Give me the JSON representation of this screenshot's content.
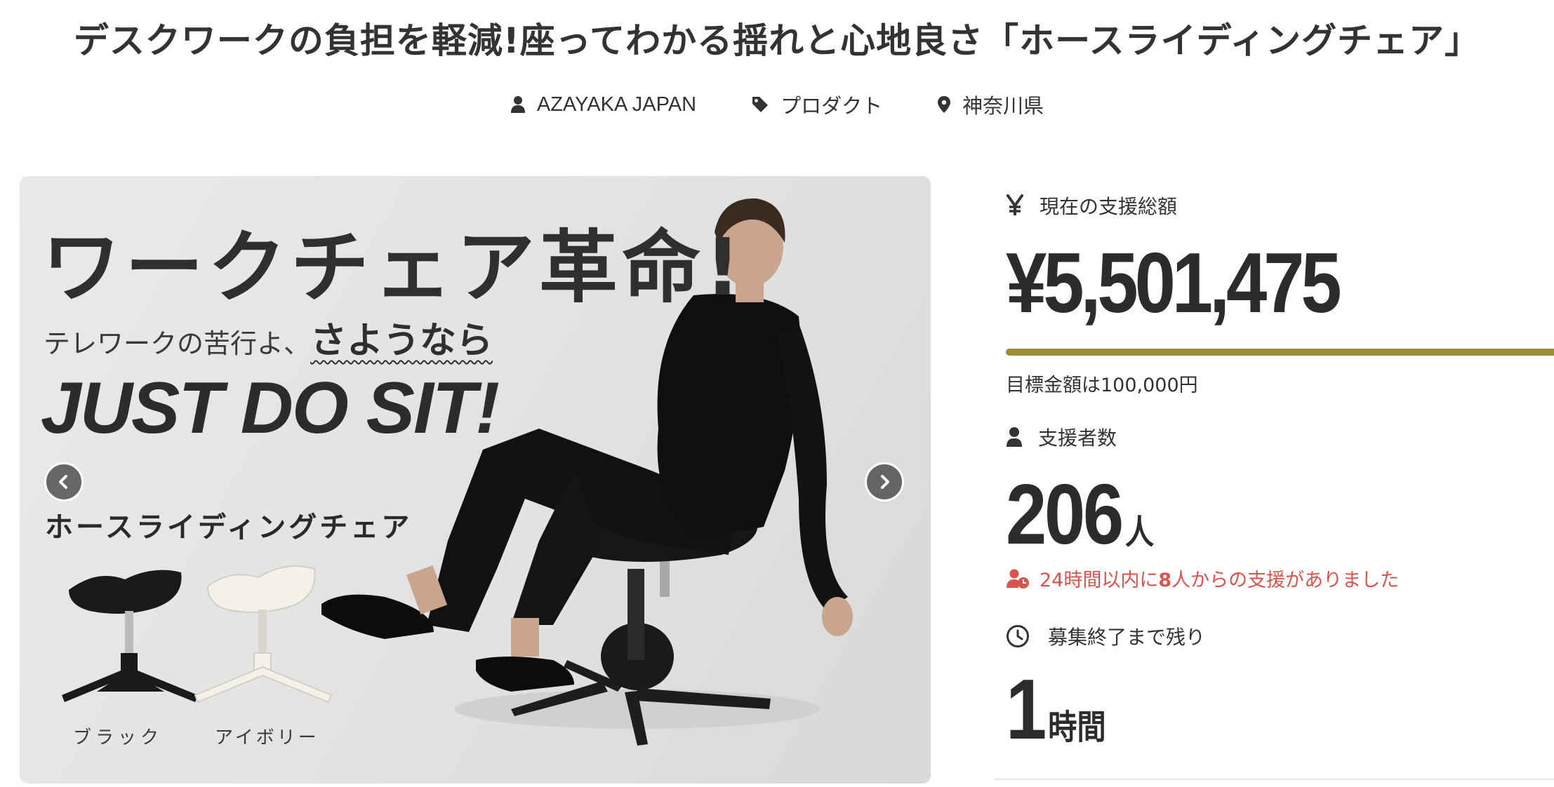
{
  "header": {
    "title": "デスクワークの負担を軽減!座ってわかる揺れと心地良さ「ホースライディングチェア」",
    "meta": {
      "owner": "AZAYAKA JAPAN",
      "category": "プロダクト",
      "location": "神奈川県"
    }
  },
  "hero": {
    "headline": "ワークチェア革命!",
    "sub_prefix": "テレワークの苦行よ、",
    "sub_emphasis": "さようなら",
    "slogan": "JUST DO SIT!",
    "product_name": "ホースライディングチェア",
    "variants": [
      "ブラック",
      "アイボリー"
    ],
    "carousel": {
      "prev_icon": "chevron-left-icon",
      "next_icon": "chevron-right-icon"
    }
  },
  "stats": {
    "amount_label": "現在の支援総額",
    "amount_icon": "yen-icon",
    "amount_value": "¥5,501,475",
    "progress_fraction": 1.0,
    "progress_color": "#9a8d35",
    "goal_text": "目標金額は100,000円",
    "backers_label": "支援者数",
    "backers_value": "206",
    "backers_unit": "人",
    "recent_prefix": "24時間以内に",
    "recent_count": "8",
    "recent_suffix": "人からの支援がありました",
    "recent_color": "#d9534f",
    "remaining_label": "募集終了まで残り",
    "remaining_value": "1",
    "remaining_unit": "時間"
  }
}
